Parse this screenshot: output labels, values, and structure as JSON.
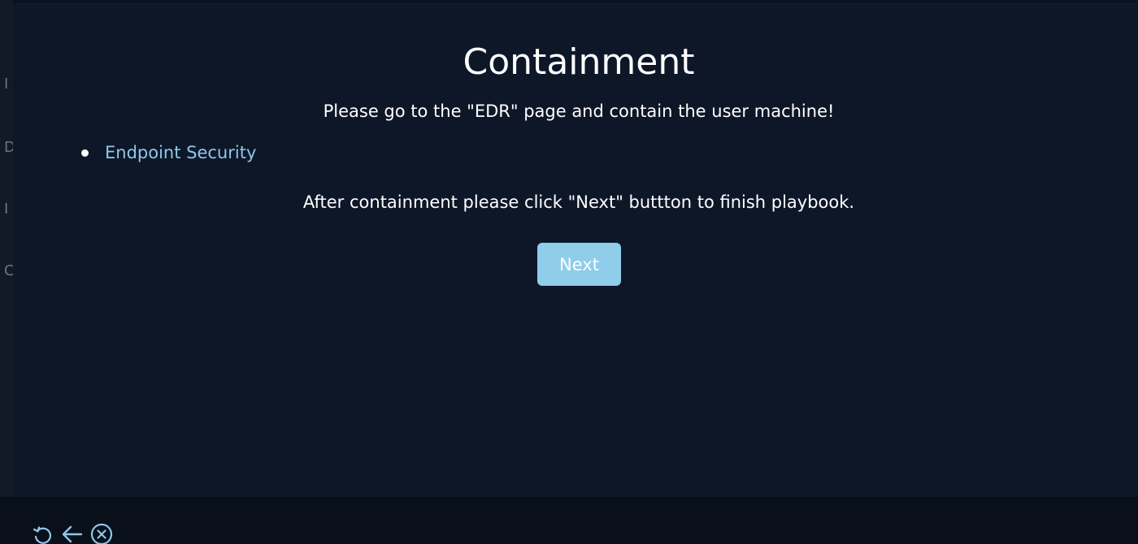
{
  "background_peek": {
    "letters": [
      "I",
      "D",
      "I",
      "C"
    ]
  },
  "modal": {
    "title": "Containment",
    "instruction": "Please go to the \"EDR\" page and contain the user machine!",
    "links": [
      {
        "label": "Endpoint Security"
      }
    ],
    "after_text": "After containment please click \"Next\" buttton to finish playbook.",
    "next_label": "Next"
  },
  "toolbar": {
    "icons": [
      "refresh-icon",
      "back-arrow-icon",
      "close-circle-icon"
    ]
  },
  "colors": {
    "background": "#0b1220",
    "modal_bg": "#0e1728",
    "accent": "#8fcdea",
    "link": "#8ec7ea",
    "text": "#ffffff"
  }
}
